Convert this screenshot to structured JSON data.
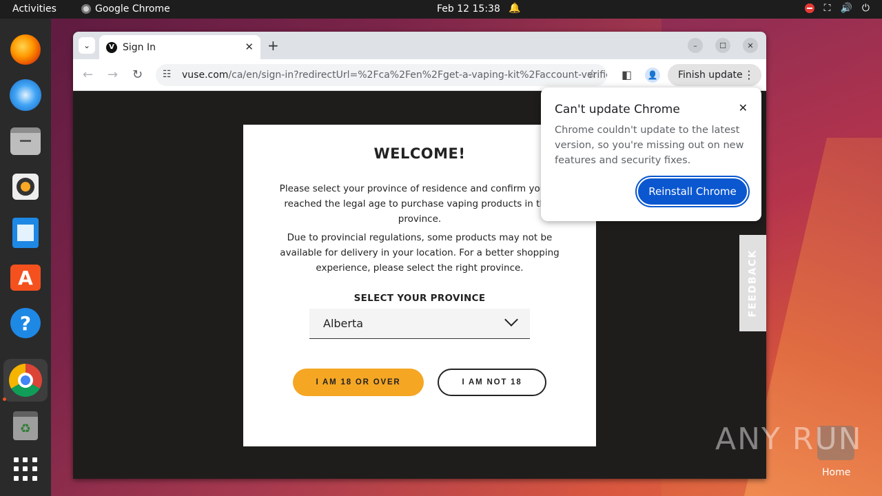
{
  "topbar": {
    "activities": "Activities",
    "app_name": "Google Chrome",
    "clock": "Feb 12  15:38"
  },
  "browser": {
    "tab_title": "Sign In",
    "url_host": "vuse.com",
    "url_path": "/ca/en/sign-in?redirectUrl=%2Fca%2Fen%2Fget-a-vaping-kit%2Faccount-verifica...",
    "finish_update": "Finish update"
  },
  "modal": {
    "title": "WELCOME!",
    "paragraph1": "Please select your province of residence and confirm you've reached the legal age to purchase vaping products in that province.",
    "paragraph2": "Due to provincial regulations, some products may not be available for delivery in your location. For a better shopping experience, please select the right province.",
    "select_label": "SELECT YOUR PROVINCE",
    "selected_province": "Alberta",
    "btn_over18": "I AM 18 OR OVER",
    "btn_not18": "I AM NOT 18"
  },
  "feedback": "FEEDBACK",
  "update_popup": {
    "title": "Can't update Chrome",
    "body": "Chrome couldn't update to the latest version, so you're missing out on new features and security fixes.",
    "button": "Reinstall Chrome"
  },
  "desktop": {
    "watermark": "ANY RUN",
    "home_label": "Home"
  },
  "colors": {
    "accent_orange": "#f5a623",
    "chrome_blue": "#0b57d0"
  }
}
